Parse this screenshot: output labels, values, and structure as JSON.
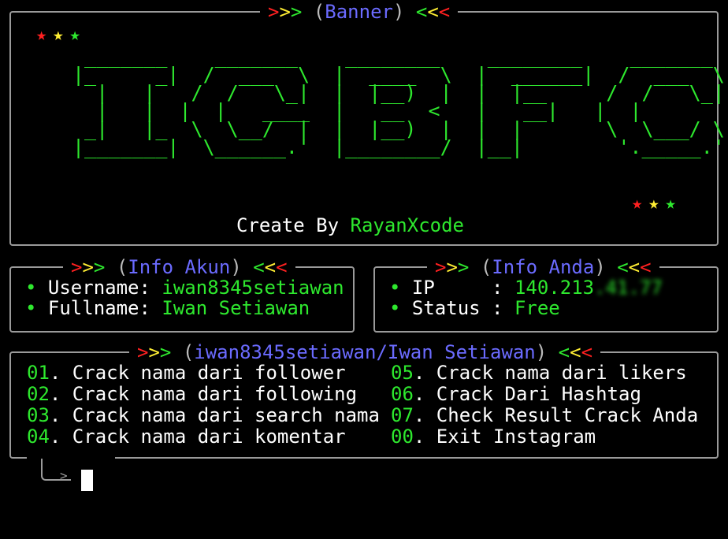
{
  "banner": {
    "title_open": ">>> (",
    "title": "Banner",
    "title_close": ") <<<",
    "star": "★",
    "ascii_art": " _______    _______    ________    ________    _______\n|_     _|  /  ___  \\  |  ____  \\  |  ______|  /  ___  \\\n  |   |   /  /   \\_|  |  |__)  |  |  |__     /  /   \\_|\n  |   |  |  |   ____  |   __  <   |   __|   |  |\n _|   |_  \\  \\__/  |  |  |__)  |  |  |       \\  \\___/ \\\n|_______|  \\______.'  |________/  |__|        '._____.'",
    "credit_label": "Create By ",
    "credit_name": "RayanXcode"
  },
  "info_akun": {
    "title_open": ">>> (",
    "title": "Info Akun",
    "title_close": ") <<<",
    "bullet": "•",
    "username_label": "Username: ",
    "username": "iwan8345setiawan",
    "fullname_label": "Fullname: ",
    "fullname": "Iwan Setiawan"
  },
  "info_anda": {
    "title_open": ">>> (",
    "title": "Info Anda",
    "title_close": ") <<<",
    "bullet": "•",
    "ip_label": "IP     : ",
    "ip": "140.213",
    "ip_masked": ".41.77",
    "status_label": "Status : ",
    "status": "Free"
  },
  "menu": {
    "title_open": ">>> (",
    "title": "iwan8345setiawan/Iwan Setiawan",
    "title_close": ") <<<",
    "left": [
      {
        "num": "01",
        "label": ". Crack nama dari follower"
      },
      {
        "num": "02",
        "label": ". Crack nama dari following"
      },
      {
        "num": "03",
        "label": ". Crack nama dari search nama"
      },
      {
        "num": "04",
        "label": ". Crack nama dari komentar"
      }
    ],
    "right": [
      {
        "num": "05",
        "label": ". Crack nama dari likers"
      },
      {
        "num": "06",
        "label": ". Crack Dari Hashtag"
      },
      {
        "num": "07",
        "label": ". Check Result Crack Anda"
      },
      {
        "num": "00",
        "label": ". Exit Instagram"
      }
    ]
  },
  "prompt": {
    "arrow": ">"
  },
  "colors": {
    "green": "#2ee82e",
    "red": "#ff2020",
    "yellow": "#ffee33",
    "blue": "#6b6bff",
    "border": "#9a9a9a"
  }
}
